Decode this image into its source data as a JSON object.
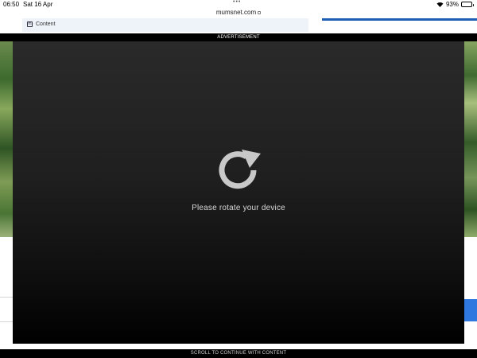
{
  "status_bar": {
    "time": "06:50",
    "date": "Sat 16 Apr",
    "battery": "93%"
  },
  "browser": {
    "url": "mumsnet.com"
  },
  "page": {
    "section_label": "Content"
  },
  "ad": {
    "label": "ADVERTISEMENT",
    "message": "Please rotate your device",
    "scroll_hint": "SCROLL TO CONTINUE WITH CONTENT"
  },
  "colors": {
    "accent_blue": "#1e5fb5",
    "button_blue": "#2f78e0",
    "overlay_black": "#000000"
  },
  "icons": {
    "rotate": "rotate-icon",
    "lock": "lock-icon",
    "wifi": "wifi-icon",
    "battery": "battery-icon"
  }
}
